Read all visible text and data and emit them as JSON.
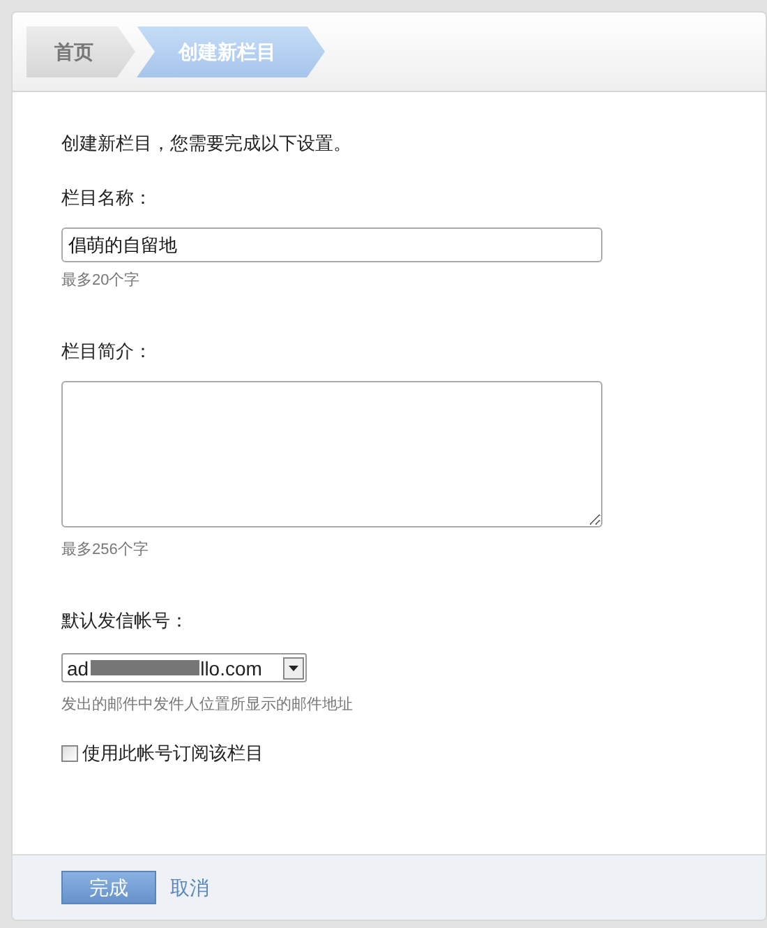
{
  "breadcrumb": [
    {
      "label": "首页",
      "selected": false
    },
    {
      "label": "创建新栏目",
      "selected": true
    }
  ],
  "intro": "创建新栏目，您需要完成以下设置。",
  "name_field": {
    "label": "栏目名称：",
    "value": "倡萌的自留地",
    "hint": "最多20个字"
  },
  "description_field": {
    "label": "栏目简介：",
    "hint": "最多256个字"
  },
  "sender_field": {
    "label": "默认发信帐号：",
    "value_start": "ad",
    "value_end": "llo.com",
    "hint": "发出的邮件中发件人位置所显示的邮件地址"
  },
  "subscribe_checkbox": {
    "label": "使用此帐号订阅该栏目",
    "checked": false
  },
  "buttons": {
    "submit": "完成",
    "cancel": "取消"
  }
}
